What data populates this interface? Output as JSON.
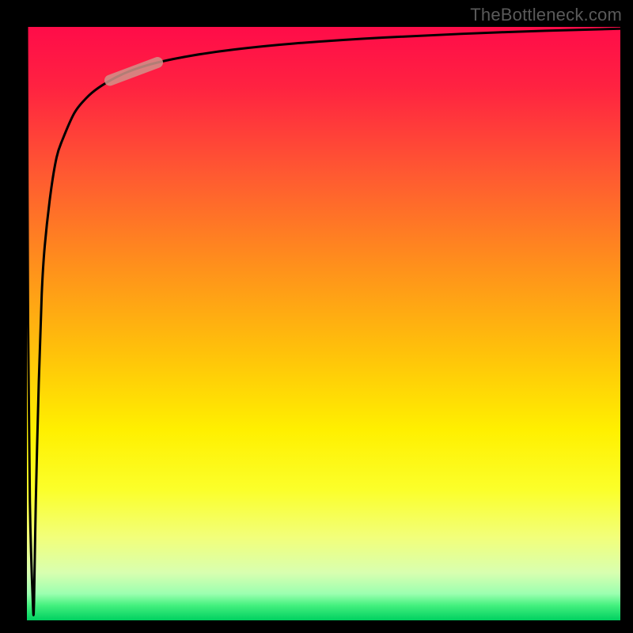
{
  "watermark": "TheBottleneck.com",
  "chart_data": {
    "type": "line",
    "title": "",
    "xlabel": "",
    "ylabel": "",
    "xlim": [
      0,
      100
    ],
    "ylim": [
      0,
      100
    ],
    "grid": false,
    "legend": false,
    "annotations": [],
    "series": [
      {
        "name": "bottleneck-curve",
        "x": [
          0.0,
          0.2,
          0.5,
          1.0,
          1.2,
          1.5,
          2.0,
          2.5,
          3.0,
          4.0,
          5.0,
          6.0,
          8.0,
          10.0,
          12.0,
          15.0,
          18.0,
          22.0,
          28.0,
          35.0,
          45.0,
          60.0,
          80.0,
          100.0
        ],
        "y": [
          100.0,
          50.0,
          20.0,
          3.0,
          3.0,
          20.0,
          40.0,
          55.0,
          63.0,
          72.0,
          78.0,
          81.0,
          85.5,
          88.0,
          89.7,
          91.5,
          92.8,
          94.0,
          95.2,
          96.2,
          97.2,
          98.2,
          99.1,
          99.7
        ]
      },
      {
        "name": "highlight-segment",
        "x": [
          14.0,
          22.0
        ],
        "y": [
          91.0,
          94.0
        ]
      }
    ],
    "gradient_stops": [
      {
        "offset": 0.0,
        "color": "#ff0c49"
      },
      {
        "offset": 0.1,
        "color": "#ff2241"
      },
      {
        "offset": 0.25,
        "color": "#ff5a31"
      },
      {
        "offset": 0.4,
        "color": "#ff8f1c"
      },
      {
        "offset": 0.55,
        "color": "#ffc20a"
      },
      {
        "offset": 0.68,
        "color": "#fff000"
      },
      {
        "offset": 0.78,
        "color": "#fbff2a"
      },
      {
        "offset": 0.86,
        "color": "#f2ff7a"
      },
      {
        "offset": 0.92,
        "color": "#d8ffb0"
      },
      {
        "offset": 0.955,
        "color": "#9cffb0"
      },
      {
        "offset": 0.975,
        "color": "#43f07e"
      },
      {
        "offset": 1.0,
        "color": "#00d060"
      }
    ]
  },
  "colors": {
    "curve": "#000000",
    "highlight": "#d1938a",
    "background": "#000000",
    "watermark": "#5a5a5a"
  }
}
